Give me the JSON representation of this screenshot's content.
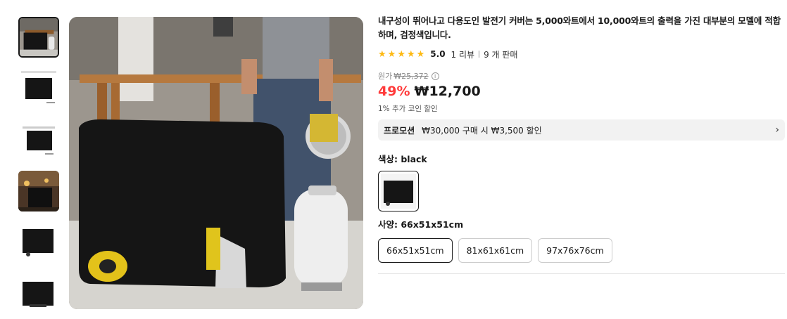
{
  "product": {
    "title": "내구성이 뛰어나고 다용도인 발전기 커버는 5,000와트에서 10,000와트의 출력을 가진 대부분의 모델에 적합하며, 검정색입니다.",
    "rating": {
      "score": "5.0",
      "stars": 5,
      "review_count": "1 리뷰",
      "sold": "9 개 판매"
    },
    "original_price_label": "원가",
    "original_price": "₩25,372",
    "discount": "49%",
    "price": "₩12,700",
    "coin_note": "1% 추가 코인 할인",
    "promotion": {
      "label": "프로모션",
      "text": "₩30,000 구매 시 ₩3,500 할인"
    },
    "color": {
      "label": "색상: black"
    },
    "size": {
      "label": "사양: 66x51x51cm",
      "options": [
        "66x51x51cm",
        "81x61x61cm",
        "97x76x76cm"
      ],
      "selected": "66x51x51cm"
    }
  },
  "icons": {
    "star": "star-icon",
    "info": "info-icon",
    "chevron": "chevron-right-icon"
  },
  "colors": {
    "discount": "#ff3b3b",
    "star": "#fdb913"
  }
}
